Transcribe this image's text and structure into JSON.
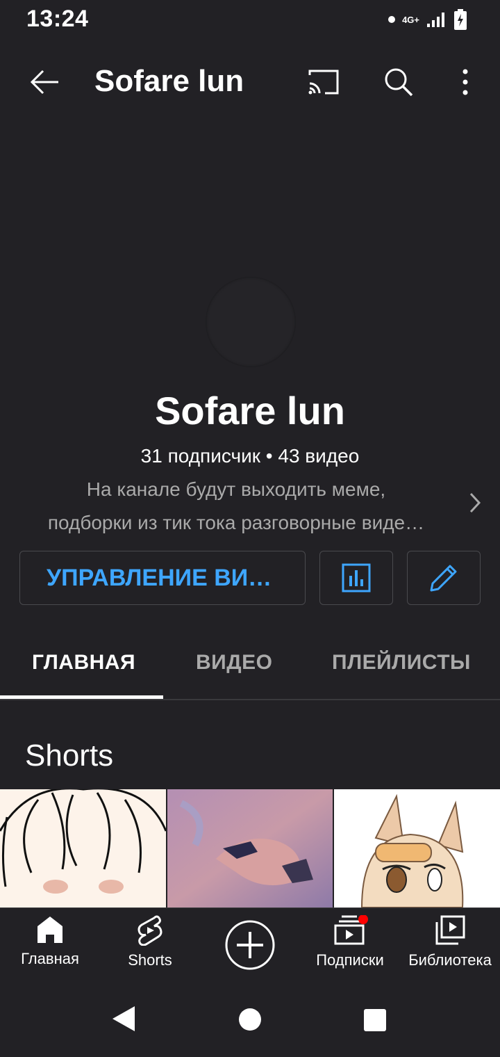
{
  "status_bar": {
    "time": "13:24",
    "network": "4G+"
  },
  "app_bar": {
    "title": "Sofare lun"
  },
  "channel": {
    "name": "Sofare lun",
    "stats": "31 подписчик • 43 видео",
    "description_line1": "На канале будут выходить меме,",
    "description_line2": "подборки из тик тока разговорные виде…"
  },
  "buttons": {
    "manage_label": "УПРАВЛЕНИЕ ВИ…"
  },
  "tabs": [
    {
      "label": "ГЛАВНАЯ",
      "active": true
    },
    {
      "label": "ВИДЕО",
      "active": false
    },
    {
      "label": "ПЛЕЙЛИСТЫ",
      "active": false
    }
  ],
  "section": {
    "title": "Shorts"
  },
  "bottom_nav": [
    {
      "label": "Главная",
      "icon": "home-icon"
    },
    {
      "label": "Shorts",
      "icon": "shorts-icon"
    },
    {
      "label": "",
      "icon": "create-icon"
    },
    {
      "label": "Подписки",
      "icon": "subscriptions-icon"
    },
    {
      "label": "Библиотека",
      "icon": "library-icon"
    }
  ],
  "colors": {
    "background": "#222125",
    "accent": "#3ea6ff",
    "notification": "#ff0000"
  }
}
